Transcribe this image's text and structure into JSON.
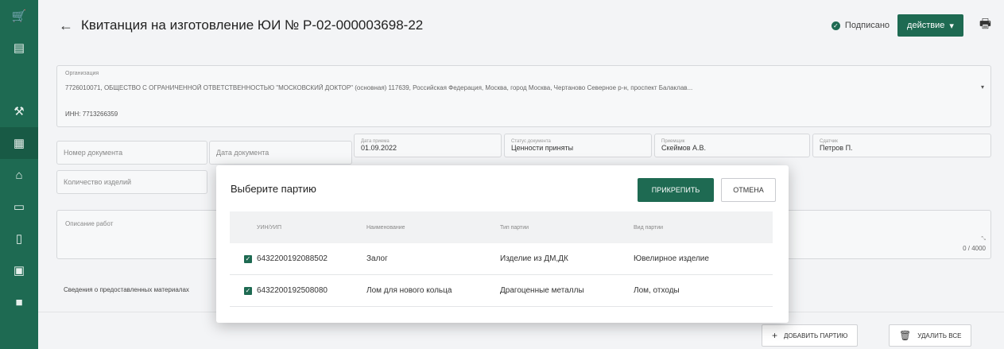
{
  "sidebar": {
    "items": [
      {
        "icon": "cart-icon",
        "glyph": "🛒"
      },
      {
        "icon": "list-icon",
        "glyph": "▤"
      },
      {
        "icon": "tools-icon",
        "glyph": "⚒"
      },
      {
        "icon": "document-icon",
        "glyph": "▦"
      },
      {
        "icon": "bank-icon",
        "glyph": "⌂"
      },
      {
        "icon": "card-icon",
        "glyph": "▭"
      },
      {
        "icon": "file-icon",
        "glyph": "▯"
      },
      {
        "icon": "briefcase-icon",
        "glyph": "▣"
      },
      {
        "icon": "archive-icon",
        "glyph": "■"
      }
    ]
  },
  "header": {
    "back_glyph": "←",
    "title": "Квитанция на изготовление ЮИ № Р-02-000003698-22",
    "status": "Подписано",
    "actions_label": "действие",
    "actions_caret": "▾",
    "print_glyph": "🖶"
  },
  "form": {
    "org_label": "Организация",
    "org_value": "7726010071, ОБЩЕСТВО С ОГРАНИЧЕННОЙ ОТВЕТСТВЕННОСТЬЮ \"МОСКОВСКИЙ ДОКТОР\" (основная) 117639, Российская Федерация, Москва, город Москва, Чертаново Северное р-н, проспект Балаклав...",
    "org_caret": "▾",
    "inn": "ИНН: 7713266359",
    "doc_number_placeholder": "Номер документа",
    "doc_date_placeholder": "Дата документа",
    "date_label": "Дата приема",
    "date_value": "01.09.2022",
    "doc_status_label": "Статус документа",
    "doc_status_value": "Ценности приняты",
    "accepted_by_label": "Приемщик",
    "accepted_by_value": "Скеймов А.В.",
    "handed_by_label": "Сдатчик",
    "handed_by_value": "Петров П.",
    "qty_placeholder": "Количество изделий",
    "description_placeholder": "Описание работ",
    "counter": "0 / 4000",
    "materials_label": "Сведения о предоставленных материалах"
  },
  "bottom": {
    "add_batch": "добавить партию",
    "delete_all": "удалить все"
  },
  "modal": {
    "title": "Выберите партию",
    "attach_label": "прикрепить",
    "cancel_label": "отмена",
    "columns": [
      "УИН/УИП",
      "Наименование",
      "Тип партии",
      "Вид партии"
    ],
    "rows": [
      {
        "checked": true,
        "uin": "6432200192088502",
        "name": "Залог",
        "type": "Изделие из ДМ,ДК",
        "kind": "Ювелирное изделие"
      },
      {
        "checked": true,
        "uin": "6432200192508080",
        "name": "Лом для нового кольца",
        "type": "Драгоценные металлы",
        "kind": "Лом, отходы"
      }
    ]
  },
  "colors": {
    "accent": "#1e6a52",
    "sidebar": "#1e6a52"
  }
}
